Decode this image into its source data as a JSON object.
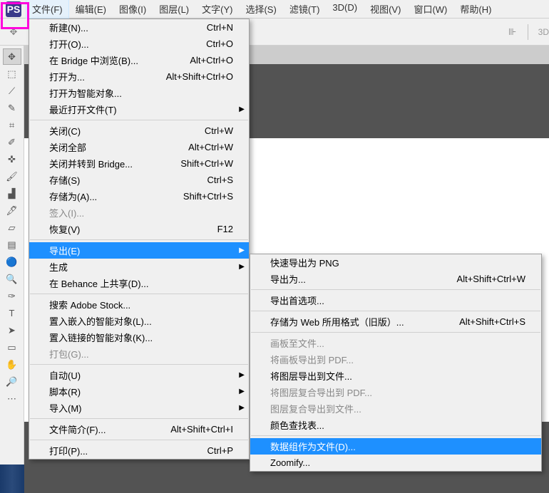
{
  "logo": "PS",
  "menubar": [
    "文件(F)",
    "编辑(E)",
    "图像(I)",
    "图层(L)",
    "文字(Y)",
    "选择(S)",
    "滤镜(T)",
    "3D(D)",
    "视图(V)",
    "窗口(W)",
    "帮助(H)"
  ],
  "menubar_active_index": 0,
  "optionsbar": {
    "text3d": "3D"
  },
  "tools": [
    {
      "name": "move-tool",
      "glyph": "✥",
      "active": true
    },
    {
      "name": "marquee-tool",
      "glyph": "⬚"
    },
    {
      "name": "lasso-tool",
      "glyph": "⟋"
    },
    {
      "name": "quick-select-tool",
      "glyph": "✎"
    },
    {
      "name": "crop-tool",
      "glyph": "⌗"
    },
    {
      "name": "eyedropper-tool",
      "glyph": "✐"
    },
    {
      "name": "healing-tool",
      "glyph": "✜"
    },
    {
      "name": "brush-tool",
      "glyph": "🖌"
    },
    {
      "name": "stamp-tool",
      "glyph": "▟"
    },
    {
      "name": "history-brush-tool",
      "glyph": "🖋"
    },
    {
      "name": "eraser-tool",
      "glyph": "▱"
    },
    {
      "name": "gradient-tool",
      "glyph": "▤"
    },
    {
      "name": "blur-tool",
      "glyph": "🔵"
    },
    {
      "name": "dodge-tool",
      "glyph": "🔍"
    },
    {
      "name": "pen-tool",
      "glyph": "✑"
    },
    {
      "name": "type-tool",
      "glyph": "T"
    },
    {
      "name": "path-select-tool",
      "glyph": "➤"
    },
    {
      "name": "shape-tool",
      "glyph": "▭"
    },
    {
      "name": "hand-tool",
      "glyph": "✋"
    },
    {
      "name": "zoom-tool",
      "glyph": "🔎"
    },
    {
      "name": "more-tool",
      "glyph": "⋯"
    }
  ],
  "file_menu": [
    {
      "label": "新建(N)...",
      "shortcut": "Ctrl+N"
    },
    {
      "label": "打开(O)...",
      "shortcut": "Ctrl+O"
    },
    {
      "label": "在 Bridge 中浏览(B)...",
      "shortcut": "Alt+Ctrl+O"
    },
    {
      "label": "打开为...",
      "shortcut": "Alt+Shift+Ctrl+O"
    },
    {
      "label": "打开为智能对象..."
    },
    {
      "label": "最近打开文件(T)",
      "submenu": true
    },
    {
      "sep": true
    },
    {
      "label": "关闭(C)",
      "shortcut": "Ctrl+W"
    },
    {
      "label": "关闭全部",
      "shortcut": "Alt+Ctrl+W"
    },
    {
      "label": "关闭并转到 Bridge...",
      "shortcut": "Shift+Ctrl+W"
    },
    {
      "label": "存储(S)",
      "shortcut": "Ctrl+S"
    },
    {
      "label": "存储为(A)...",
      "shortcut": "Shift+Ctrl+S"
    },
    {
      "label": "签入(I)...",
      "disabled": true
    },
    {
      "label": "恢复(V)",
      "shortcut": "F12"
    },
    {
      "sep": true
    },
    {
      "label": "导出(E)",
      "submenu": true,
      "highlight": true
    },
    {
      "label": "生成",
      "submenu": true
    },
    {
      "label": "在 Behance 上共享(D)..."
    },
    {
      "sep": true
    },
    {
      "label": "搜索 Adobe Stock..."
    },
    {
      "label": "置入嵌入的智能对象(L)..."
    },
    {
      "label": "置入链接的智能对象(K)..."
    },
    {
      "label": "打包(G)...",
      "disabled": true
    },
    {
      "sep": true
    },
    {
      "label": "自动(U)",
      "submenu": true
    },
    {
      "label": "脚本(R)",
      "submenu": true
    },
    {
      "label": "导入(M)",
      "submenu": true
    },
    {
      "sep": true
    },
    {
      "label": "文件简介(F)...",
      "shortcut": "Alt+Shift+Ctrl+I"
    },
    {
      "sep": true
    },
    {
      "label": "打印(P)...",
      "shortcut": "Ctrl+P"
    }
  ],
  "export_menu": [
    {
      "label": "快速导出为 PNG"
    },
    {
      "label": "导出为...",
      "shortcut": "Alt+Shift+Ctrl+W"
    },
    {
      "sep": true
    },
    {
      "label": "导出首选项..."
    },
    {
      "sep": true
    },
    {
      "label": "存储为 Web 所用格式（旧版）...",
      "shortcut": "Alt+Shift+Ctrl+S"
    },
    {
      "sep": true
    },
    {
      "label": "画板至文件...",
      "disabled": true
    },
    {
      "label": "将画板导出到 PDF...",
      "disabled": true
    },
    {
      "label": "将图层导出到文件..."
    },
    {
      "label": "将图层复合导出到 PDF...",
      "disabled": true
    },
    {
      "label": "图层复合导出到文件...",
      "disabled": true
    },
    {
      "label": "颜色查找表..."
    },
    {
      "sep": true
    },
    {
      "label": "数据组作为文件(D)...",
      "highlight": true
    },
    {
      "label": "Zoomify..."
    }
  ]
}
